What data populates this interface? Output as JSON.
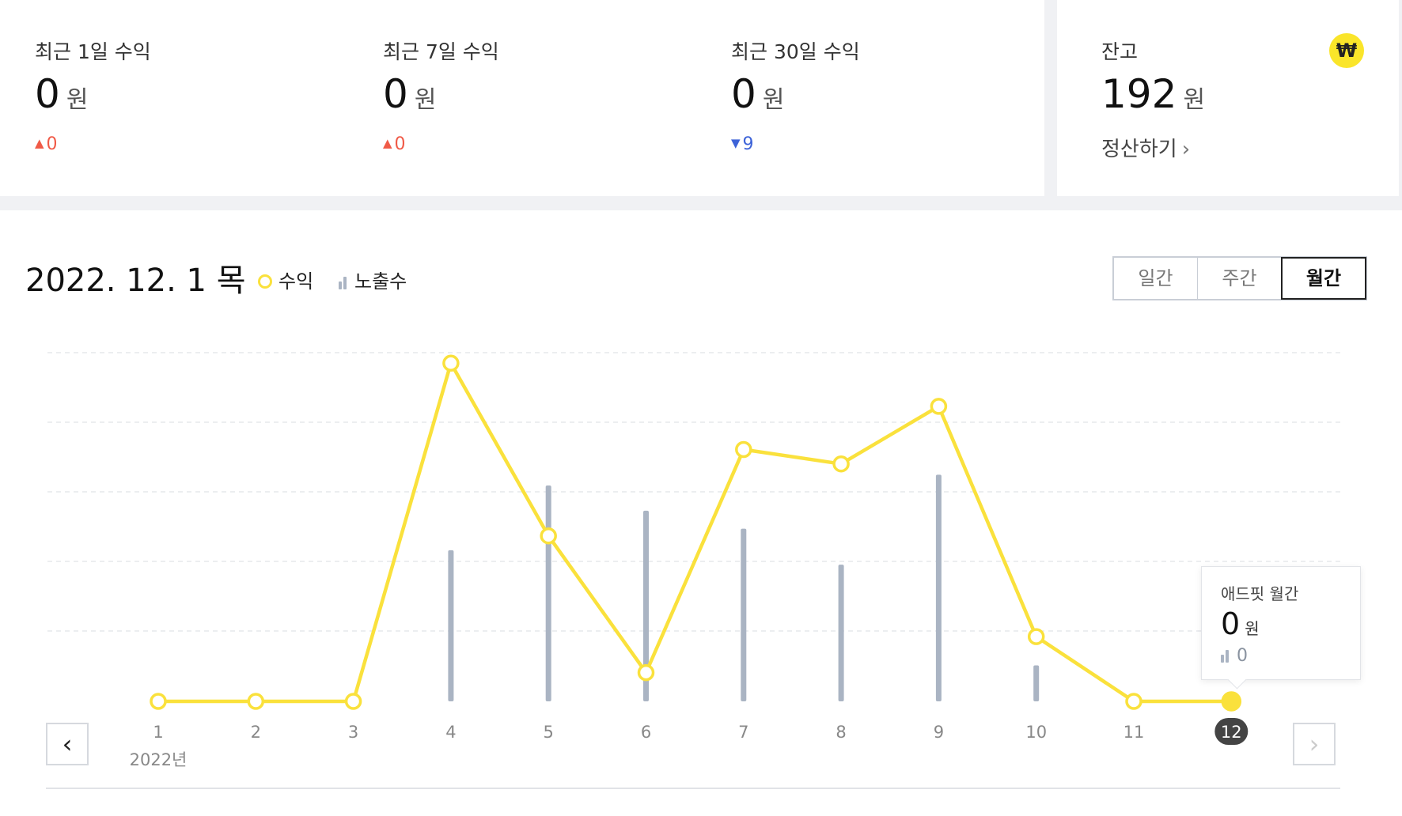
{
  "stats": [
    {
      "label": "최근 1일 수익",
      "value": "0",
      "unit": "원",
      "delta": "0",
      "direction": "up"
    },
    {
      "label": "최근 7일 수익",
      "value": "0",
      "unit": "원",
      "delta": "0",
      "direction": "up"
    },
    {
      "label": "최근 30일 수익",
      "value": "0",
      "unit": "원",
      "delta": "9",
      "direction": "down"
    }
  ],
  "balance": {
    "label": "잔고",
    "value": "192",
    "unit": "원",
    "settle_label": "정산하기",
    "badge": "₩"
  },
  "chart_header": {
    "date": "2022. 12. 1 목",
    "legend_revenue": "수익",
    "legend_impressions": "노출수",
    "tabs": [
      "일간",
      "주간",
      "월간"
    ],
    "active_tab": "월간"
  },
  "chart_data": {
    "type": "line",
    "categories": [
      "1",
      "2",
      "3",
      "4",
      "5",
      "6",
      "7",
      "8",
      "9",
      "10",
      "11",
      "12"
    ],
    "year_label": "2022년",
    "selected": "12",
    "series": [
      {
        "name": "수익",
        "type": "line",
        "color": "#fae13c",
        "values": [
          0,
          0,
          0,
          94,
          46,
          8,
          70,
          66,
          82,
          18,
          0,
          0
        ]
      },
      {
        "name": "노출수",
        "type": "bar",
        "color": "#aab4c3",
        "values": [
          0,
          0,
          0,
          42,
          60,
          53,
          48,
          38,
          63,
          10,
          0,
          0
        ]
      }
    ],
    "ylim": [
      0,
      100
    ],
    "grid": true
  },
  "tooltip": {
    "title": "애드핏 월간",
    "value": "0",
    "unit": "원",
    "impressions": "0"
  },
  "nav": {
    "prev": "‹",
    "next": "›"
  }
}
